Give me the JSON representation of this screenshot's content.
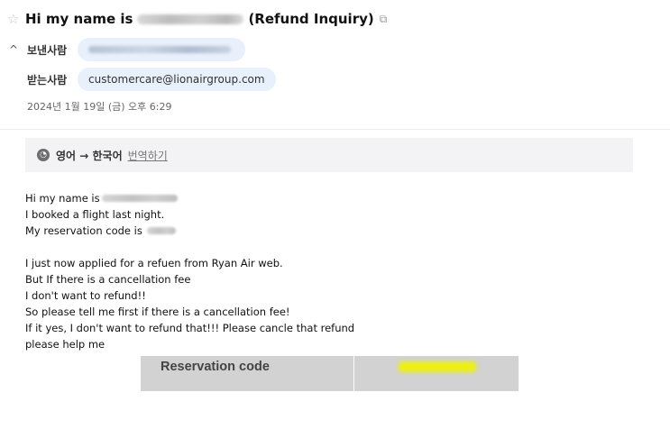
{
  "subject": {
    "prefix": "Hi my name is",
    "suffix": "(Refund Inquiry)",
    "star_icon": "star-icon",
    "external_icon": "external-link-icon"
  },
  "sender": {
    "label": "보낸사람",
    "expand_icon": "chevron-up-icon"
  },
  "receiver": {
    "label": "받는사람",
    "email": "customercare@lionairgroup.com"
  },
  "date": "2024년 1월 19일 (금) 오후 6:29",
  "translate": {
    "icon": "translate-icon",
    "direction": "영어 → 한국어",
    "link": "번역하기"
  },
  "body": {
    "line1": "Hi my name is",
    "line2": "I booked a flight last night.",
    "line3": "My reservation code is",
    "line5": "I just now applied for a refuen from Ryan Air web.",
    "line6": "But If there is a cancellation fee",
    "line7": "I don't want to refund!!",
    "line8": "So please tell me first if there is a cancellation fee!",
    "line9": "If it yes, I don't want to refund that!!! Please cancle that refund",
    "line10": "please help me"
  },
  "reservation_image": {
    "label": "Reservation code"
  },
  "colors": {
    "chip_bg": "#e8f0fb",
    "translate_bar_bg": "#f3f3f5",
    "highlight": "#ecef15"
  }
}
